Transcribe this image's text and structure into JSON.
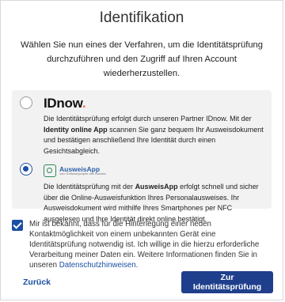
{
  "dialog": {
    "title": "Identifikation",
    "intro": "Wählen Sie nun eines der Verfahren, um die Identitätsprüfung durchzuführen und den Zugriff auf Ihren Account wiederherzustellen."
  },
  "options": [
    {
      "name": "IDnow",
      "selected": false,
      "logo_text": "IDnow",
      "desc_part1": "Die Identitätsprüfung erfolgt durch unseren Partner IDnow. Mit der ",
      "desc_bold": "Identity online App",
      "desc_part2": " scannen Sie ganz bequem Ihr Ausweisdokument und bestätigen anschließend Ihre Identität durch einen Gesichtsabgleich."
    },
    {
      "name": "AusweisApp",
      "selected": true,
      "logo_text": "AusweisApp",
      "logo_sub": "vom Softwareprojekt des Bundes",
      "desc_part1": "Die Identitätsprüfung mit der ",
      "desc_bold": "AusweisApp",
      "desc_part2": " erfolgt schnell und sicher über die Online-Ausweisfunktion Ihres Personalausweises. Ihr Ausweisdokument wird mithilfe Ihres Smartphones per NFC ausgelesen und Ihre Identität direkt online bestätigt."
    }
  ],
  "consent": {
    "checked": true,
    "text": "Mir ist bekannt, dass für die Hinterlegung einer neuen Kontaktmöglichkeit von einem unbekannten Gerät eine Identitätsprüfung notwendig ist. Ich willige in die hierzu erforderliche Verarbeitung meiner Daten ein. Weitere Informationen finden Sie in unseren ",
    "link_text": "Datenschutzhinweisen",
    "suffix": "."
  },
  "footer": {
    "back_label": "Zurück",
    "primary_label": "Zur Identitätsprüfung"
  },
  "colors": {
    "accent": "#1a4fa3",
    "primary_button": "#1f3f8c",
    "idnow_dot": "#ff6a3d",
    "option_bg": "#f2f2f2"
  }
}
